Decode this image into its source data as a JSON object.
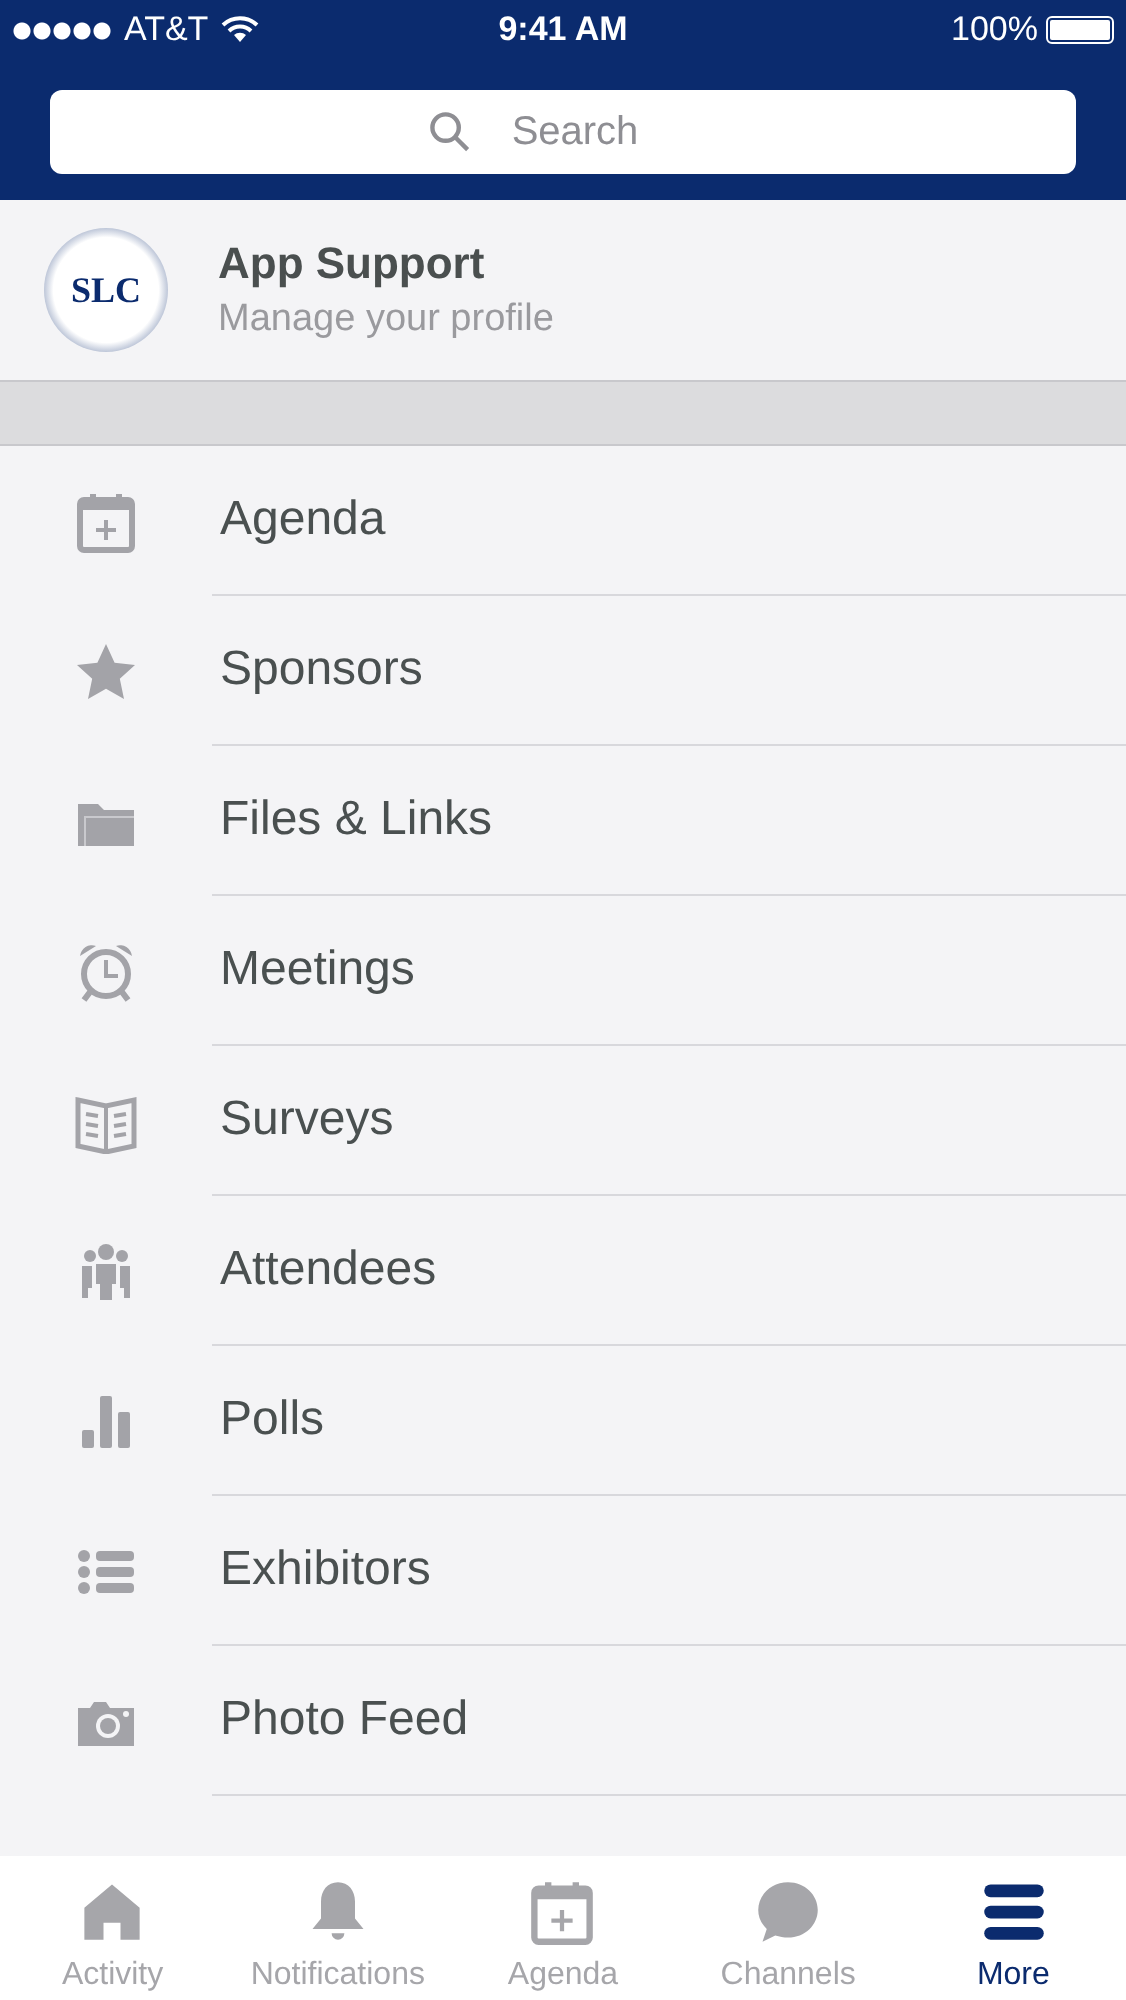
{
  "status_bar": {
    "carrier": "AT&T",
    "time": "9:41 AM",
    "battery": "100%"
  },
  "search": {
    "placeholder": "Search"
  },
  "profile": {
    "title": "App Support",
    "subtitle": "Manage your profile",
    "logo": "SLC"
  },
  "menu_items": [
    {
      "kind": "calendar",
      "label": "Agenda"
    },
    {
      "kind": "star",
      "label": "Sponsors"
    },
    {
      "kind": "folder",
      "label": "Files & Links"
    },
    {
      "kind": "alarm",
      "label": "Meetings"
    },
    {
      "kind": "book",
      "label": "Surveys"
    },
    {
      "kind": "people",
      "label": "Attendees"
    },
    {
      "kind": "bars",
      "label": "Polls"
    },
    {
      "kind": "list",
      "label": "Exhibitors"
    },
    {
      "kind": "camera",
      "label": "Photo Feed"
    }
  ],
  "tab_bar": [
    {
      "kind": "home",
      "label": "Activity",
      "selected": false
    },
    {
      "kind": "bell",
      "label": "Notifications",
      "selected": false
    },
    {
      "kind": "calendar",
      "label": "Agenda",
      "selected": false
    },
    {
      "kind": "chat",
      "label": "Channels",
      "selected": false
    },
    {
      "kind": "menu",
      "label": "More",
      "selected": true
    }
  ]
}
